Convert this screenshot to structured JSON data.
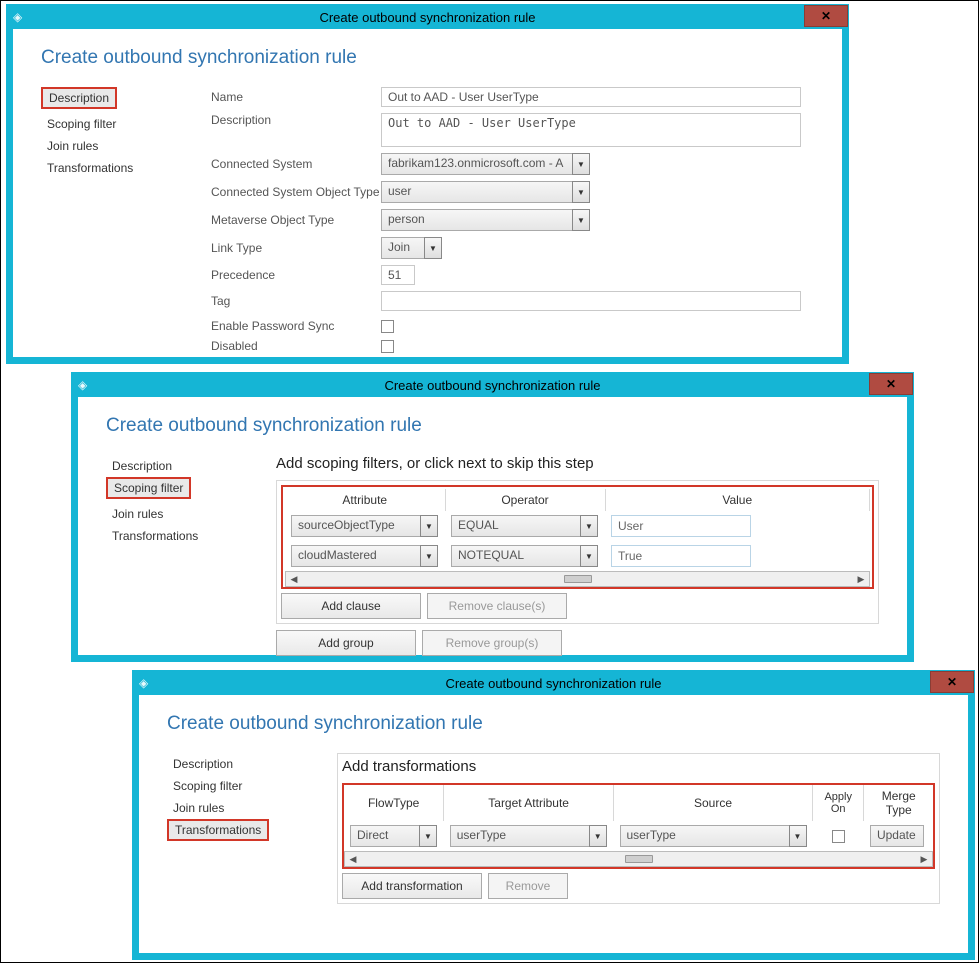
{
  "window_title": "Create outbound synchronization rule",
  "page_heading": "Create outbound synchronization rule",
  "nav": {
    "description": "Description",
    "scoping_filter": "Scoping filter",
    "join_rules": "Join rules",
    "transformations": "Transformations"
  },
  "win1": {
    "labels": {
      "name": "Name",
      "description": "Description",
      "connected_system": "Connected System",
      "cs_object_type": "Connected System Object Type",
      "mv_object_type": "Metaverse Object Type",
      "link_type": "Link Type",
      "precedence": "Precedence",
      "tag": "Tag",
      "enable_pwd_sync": "Enable Password Sync",
      "disabled": "Disabled"
    },
    "values": {
      "name": "Out to AAD - User UserType",
      "description": "Out to AAD - User UserType",
      "connected_system": "fabrikam123.onmicrosoft.com - A",
      "cs_object_type": "user",
      "mv_object_type": "person",
      "link_type": "Join",
      "precedence": "51"
    }
  },
  "win2": {
    "instruction": "Add scoping filters, or click next to skip this step",
    "headers": {
      "attribute": "Attribute",
      "operator": "Operator",
      "value": "Value"
    },
    "rows": [
      {
        "attribute": "sourceObjectType",
        "operator": "EQUAL",
        "value": "User"
      },
      {
        "attribute": "cloudMastered",
        "operator": "NOTEQUAL",
        "value": "True"
      }
    ],
    "buttons": {
      "add_clause": "Add clause",
      "remove_clause": "Remove clause(s)",
      "add_group": "Add group",
      "remove_group": "Remove group(s)"
    }
  },
  "win3": {
    "heading": "Add transformations",
    "headers": {
      "flowtype": "FlowType",
      "target": "Target Attribute",
      "source": "Source",
      "apply": "Apply On",
      "merge": "Merge Type"
    },
    "rows": [
      {
        "flowtype": "Direct",
        "target": "userType",
        "source": "userType",
        "merge": "Update"
      }
    ],
    "buttons": {
      "add_transformation": "Add transformation",
      "remove": "Remove"
    }
  }
}
